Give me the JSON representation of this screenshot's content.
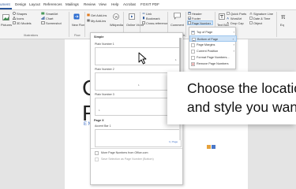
{
  "menubar": {
    "tabs": [
      {
        "label": "ument"
      },
      {
        "label": "Design"
      },
      {
        "label": "Layout"
      },
      {
        "label": "References"
      },
      {
        "label": "Mailings"
      },
      {
        "label": "Review"
      },
      {
        "label": "View"
      },
      {
        "label": "Help"
      },
      {
        "label": "Acrobat"
      },
      {
        "label": "FOXIT PDF"
      }
    ],
    "active_index": 0
  },
  "ribbon": {
    "pictures": "Pictures",
    "shapes": "Shapes",
    "icons": "Icons",
    "models_3d": "3D Models",
    "smartart": "SmartArt",
    "chart": "Chart",
    "screenshot": "Screenshot",
    "illustrations_group": "Illustrations",
    "new_flow": "New Flow",
    "flow_group": "Flow",
    "get_addins": "Get Add-ins",
    "my_addins": "My Add-ins",
    "addins_group": "Add-ins",
    "wikipedia": "Wikipedia",
    "online_video": "Online Video",
    "media_group": "Media",
    "link": "Link",
    "bookmark": "Bookmark",
    "cross_reference": "Cross-reference",
    "links_group": "Links",
    "comment": "Comment",
    "comments_group": "Comments",
    "header": "Header",
    "footer": "Footer",
    "page_number": "Page Number",
    "text_box": "Text Box",
    "quick_parts": "Quick Parts",
    "wordart": "WordArt",
    "drop_cap": "Drop Cap",
    "signature_line": "Signature Line",
    "date_time": "Date & Time",
    "object": "Object",
    "equation": "Eq"
  },
  "gallery": {
    "section_simple": "Simple",
    "plain_number_1": "Plain Number 1",
    "plain_number_2": "Plain Number 2",
    "plain_number_3": "Plain Number 3",
    "section_page_x": "Page X",
    "accent_bar_1": "Accent Bar 1",
    "thumb_num": "1",
    "accent_text": "1 | Page",
    "more_from_office": "More Page Numbers from Office.com",
    "save_selection": "Save Selection as Page Number (Bottom)"
  },
  "page_number_menu": {
    "items": [
      {
        "label": "Top of Page",
        "has_arrow": true
      },
      {
        "label": "Bottom of Page",
        "has_arrow": true,
        "highlighted": true
      },
      {
        "label": "Page Margins",
        "has_arrow": true
      },
      {
        "label": "Current Position",
        "has_arrow": true
      },
      {
        "label": "Format Page Numbers...",
        "has_arrow": false
      },
      {
        "label": "Remove Page Numbers",
        "has_arrow": false
      }
    ]
  },
  "document": {
    "letter_1": "C",
    "letter_2": "F",
    "en_line": "EN"
  },
  "caption": {
    "line1": "Choose the location",
    "line2": "and style you want"
  },
  "colors": {
    "accent": "#2b579a",
    "highlight": "#cfe3f7",
    "doc_blue": "#3b6cc4"
  }
}
